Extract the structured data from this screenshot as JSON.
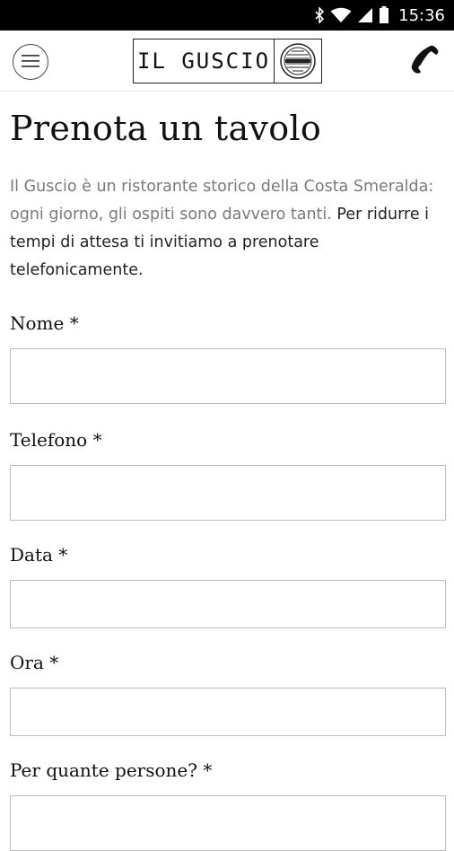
{
  "status_bar": {
    "time": "15:36",
    "icons": [
      "bluetooth-icon",
      "wifi-icon",
      "signal-icon",
      "battery-icon"
    ]
  },
  "header": {
    "logo_text": "IL GUSCIO",
    "logo_emblem_icon": "shell-emblem-icon",
    "menu_icon": "hamburger-menu-icon",
    "phone_icon": "phone-icon"
  },
  "page": {
    "title": "Prenota un tavolo",
    "intro_light": "Il Guscio è un ristorante storico della Costa Smeralda: ogni giorno, gli ospiti sono davvero tanti.",
    "intro_dark": " Per ridurre i tempi di attesa  ti invitiamo a prenotare telefonicamente."
  },
  "form": {
    "fields": [
      {
        "label": "Nome *",
        "value": "",
        "placeholder": ""
      },
      {
        "label": "Telefono *",
        "value": "",
        "placeholder": ""
      },
      {
        "label": "Data *",
        "value": "",
        "placeholder": ""
      },
      {
        "label": "Ora *",
        "value": "",
        "placeholder": ""
      },
      {
        "label": "Per quante persone? *",
        "value": "",
        "placeholder": ""
      }
    ]
  }
}
